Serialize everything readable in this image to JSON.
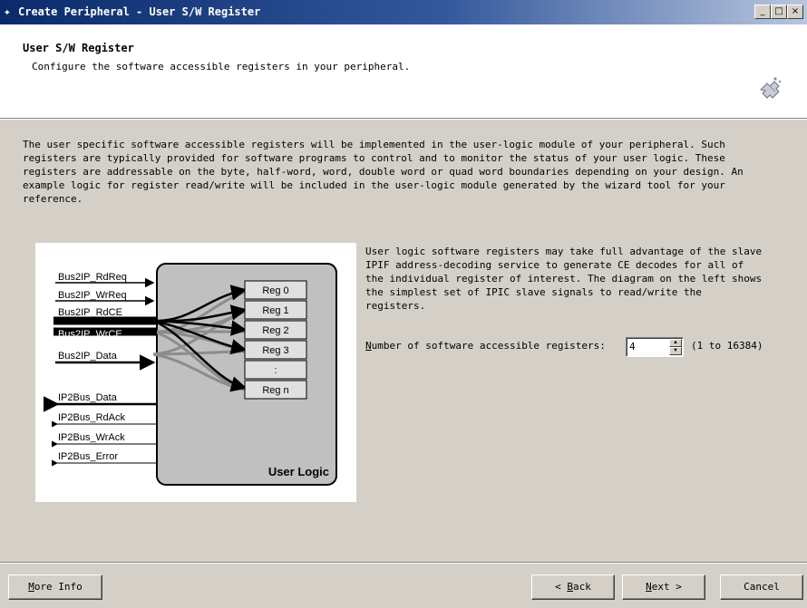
{
  "window": {
    "title": "Create Peripheral - User S/W Register",
    "icon": "gem-icon",
    "controls": [
      "_",
      "□",
      "×"
    ]
  },
  "header": {
    "title": "User S/W Register",
    "subtitle": "Configure the software accessible registers in your peripheral."
  },
  "description": "The user specific software accessible registers will be implemented in the user-logic module of your peripheral. Such\nregisters are typically provided for software programs to control and to monitor the status of your user logic. These\nregisters are addressable on the byte, half-word, word, double word or quad word boundaries depending on your design. An\nexample logic for register read/write will be included in the user-logic module generated by the wizard tool for your\nreference.",
  "diagram": {
    "inputs": [
      "Bus2IP_RdReq",
      "Bus2IP_WrReq",
      "Bus2IP_RdCE",
      "Bus2IP_WrCE",
      "Bus2IP_Data"
    ],
    "outputs": [
      "IP2Bus_Data",
      "IP2Bus_RdAck",
      "IP2Bus_WrAck",
      "IP2Bus_Error"
    ],
    "registers": [
      "Reg 0",
      "Reg 1",
      "Reg 2",
      "Reg 3",
      ":",
      "Reg n"
    ],
    "block_label": "User Logic"
  },
  "side_text": "User logic software registers may take full advantage of the slave\nIPIF address-decoding service to generate CE decodes for all of\nthe individual register of interest. The diagram on the left shows\nthe simplest set of IPIC slave signals to read/write the\nregisters.",
  "register_count": {
    "label_prefix": "N",
    "label_rest": "umber of software accessible registers:",
    "value": "4",
    "range": "(1 to 16384)"
  },
  "buttons": {
    "more_info": {
      "u": "M",
      "rest": "ore Info"
    },
    "back": {
      "pre": "< ",
      "u": "B",
      "rest": "ack"
    },
    "next": {
      "u": "N",
      "rest": "ext >"
    },
    "cancel": "Cancel"
  }
}
